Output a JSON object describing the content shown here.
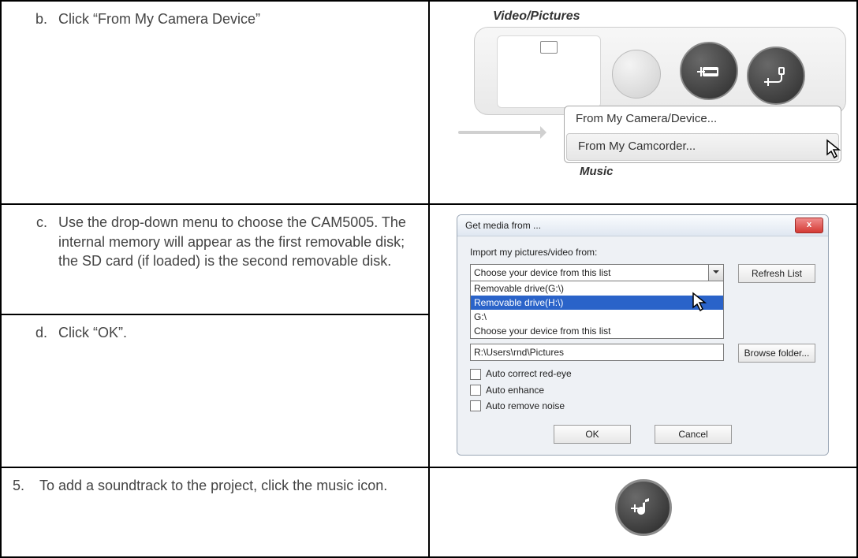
{
  "row1": {
    "bullet": "b.",
    "text": "Click “From My Camera Device”",
    "shot": {
      "title": "Video/Pictures",
      "menu_item_1": "From My Camera/Device...",
      "menu_item_2": "From My Camcorder...",
      "music_label": "Music"
    }
  },
  "row2": {
    "c_bullet": "c.",
    "c_text": "Use the drop-down menu to choose the CAM5005. The internal memory will appear as the first removable disk; the SD card (if loaded) is the second removable disk.",
    "d_bullet": "d.",
    "d_text": "Click “OK”.",
    "dialog": {
      "title": "Get media from ...",
      "close_x": "x",
      "import_label": "Import my pictures/video from:",
      "combo_value": "Choose your device from this list",
      "opt1": "Removable drive(G:\\)",
      "opt2": "Removable drive(H:\\)",
      "opt3": "G:\\",
      "opt4": "Choose your device from this list",
      "refresh": "Refresh List",
      "path": "R:\\Users\\rnd\\Pictures",
      "browse": "Browse folder...",
      "chk1": "Auto correct red-eye",
      "chk2": "Auto enhance",
      "chk3": "Auto remove noise",
      "ok": "OK",
      "cancel": "Cancel"
    }
  },
  "row3": {
    "num": "5.",
    "text": "To add a soundtrack to the project, click the music icon."
  }
}
